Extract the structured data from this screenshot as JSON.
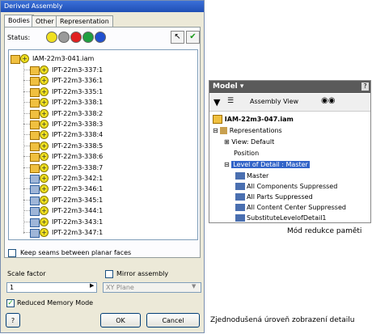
{
  "dialog": {
    "title": "Derived Assembly",
    "tabs": [
      "Bodies",
      "Other",
      "Representation"
    ],
    "status_label": "Status:",
    "root_label": "IAM-22m3-041.iam",
    "items": [
      "IPT-22m3-337:1",
      "IPT-22m3-336:1",
      "IPT-22m3-335:1",
      "IPT-22m3-338:1",
      "IPT-22m3-338:2",
      "IPT-22m3-338:3",
      "IPT-22m3-338:4",
      "IPT-22m3-338:5",
      "IPT-22m3-338:6",
      "IPT-22m3-338:7",
      "IPT-22m3-342:1",
      "IPT-22m3-346:1",
      "IPT-22m3-345:1",
      "IPT-22m3-344:1",
      "IPT-22m3-343:1",
      "IPT-22m3-347:1"
    ],
    "keep_seams_label": "Keep seams between planar faces",
    "scale_factor_label": "Scale factor",
    "scale_factor_value": "1",
    "mirror_label": "Mirror assembly",
    "plane_value": "XY Plane",
    "reduced_memory_label": "Reduced Memory Mode",
    "ok_label": "OK",
    "cancel_label": "Cancel",
    "help_label": "?"
  },
  "model": {
    "title": "Model ▾",
    "help": "?",
    "view_label": "Assembly View",
    "root": "IAM-22m3-047.iam",
    "representations": "Representations",
    "view_default": "View: Default",
    "position": "Position",
    "lod_master_selected": "Level of Detail : Master",
    "lod_items": [
      "Master",
      "All Components Suppressed",
      "All Parts Suppressed",
      "All Content Center Suppressed",
      "SubstituteLevelofDetail1"
    ]
  },
  "captions": {
    "memory": "Mód redukce paměti",
    "lod": "Zjednodušená úroveň zobrazení detailu"
  },
  "colors": {
    "title_bar": "#2a5fc8",
    "dialog_bg": "#ece9d8",
    "plus_icon": "#f0e020",
    "selection": "#3264c8"
  }
}
